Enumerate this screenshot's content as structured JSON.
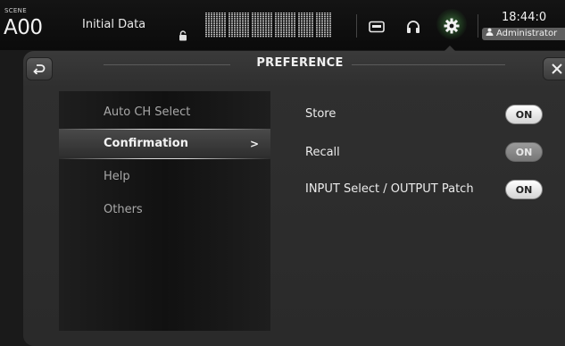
{
  "topbar": {
    "scene_caption": "SCENE",
    "scene_number": "A00",
    "scene_title": "Initial Data",
    "clock": "18:44:0",
    "user_label": "Administrator",
    "icons": [
      "lock-icon",
      "recorder-icon",
      "headphones-icon",
      "gear-icon",
      "user-icon"
    ],
    "active_icon": "gear-icon"
  },
  "dialog": {
    "title": "PREFERENCE",
    "back_icon": "return-arrow-icon",
    "close_icon": "close-icon"
  },
  "menu": {
    "items": [
      {
        "label": "Auto CH Select",
        "active": false
      },
      {
        "label": "Confirmation",
        "active": true,
        "chevron": ">"
      },
      {
        "label": "Help",
        "active": false
      },
      {
        "label": "Others",
        "active": false
      }
    ]
  },
  "settings": [
    {
      "label": "Store",
      "state": "ON"
    },
    {
      "label": "Recall",
      "state": "ON"
    },
    {
      "label": "INPUT Select / OUTPUT Patch",
      "state": "ON"
    }
  ],
  "colors": {
    "accent_glow": "#6edc6e",
    "toggle_on": "#ffffff",
    "toggle_dim": "#8a8a8a"
  }
}
